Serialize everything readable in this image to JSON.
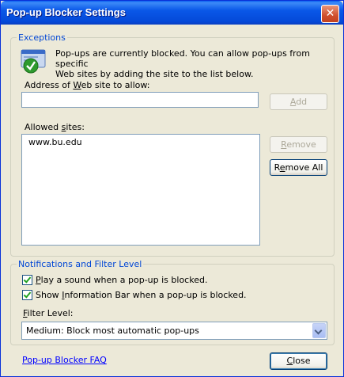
{
  "window": {
    "title": "Pop-up Blocker Settings",
    "close_glyph": "✕"
  },
  "exceptions": {
    "legend": "Exceptions",
    "description_line1": "Pop-ups are currently blocked.  You can allow pop-ups from specific",
    "description_line2": "Web sites by adding the site to the list below.",
    "address_label_pre": "Address of ",
    "address_label_u": "W",
    "address_label_post": "eb site to allow:",
    "address_value": "",
    "add_button_u": "A",
    "add_button_rest": "dd",
    "allowed_label_pre": "Allowed ",
    "allowed_label_u": "s",
    "allowed_label_post": "ites:",
    "allowed_sites": [
      "www.bu.edu"
    ],
    "remove_button_u": "R",
    "remove_button_rest": "emove",
    "remove_all_pre": "R",
    "remove_all_u": "e",
    "remove_all_post": "move All"
  },
  "notifications": {
    "legend": "Notifications and Filter Level",
    "play_sound_u": "P",
    "play_sound_rest": "lay a sound when a pop-up is blocked.",
    "play_sound_checked": true,
    "info_bar_pre": "Show ",
    "info_bar_u": "I",
    "info_bar_post": "nformation Bar when a pop-up is blocked.",
    "info_bar_checked": true,
    "filter_label_pre": "",
    "filter_label_u": "F",
    "filter_label_post": "ilter Level:",
    "filter_value": "Medium: Block most automatic pop-ups"
  },
  "footer": {
    "faq_link": "Pop-up Blocker FAQ",
    "close_button_u": "C",
    "close_button_rest": "lose"
  },
  "icons": {
    "shield": "shield-check-icon",
    "dropdown": "chevron-down-icon"
  },
  "colors": {
    "title_blue": "#0A58E8",
    "legend_blue": "#0046D5",
    "link_blue": "#0000FF",
    "close_red": "#D0502E"
  }
}
